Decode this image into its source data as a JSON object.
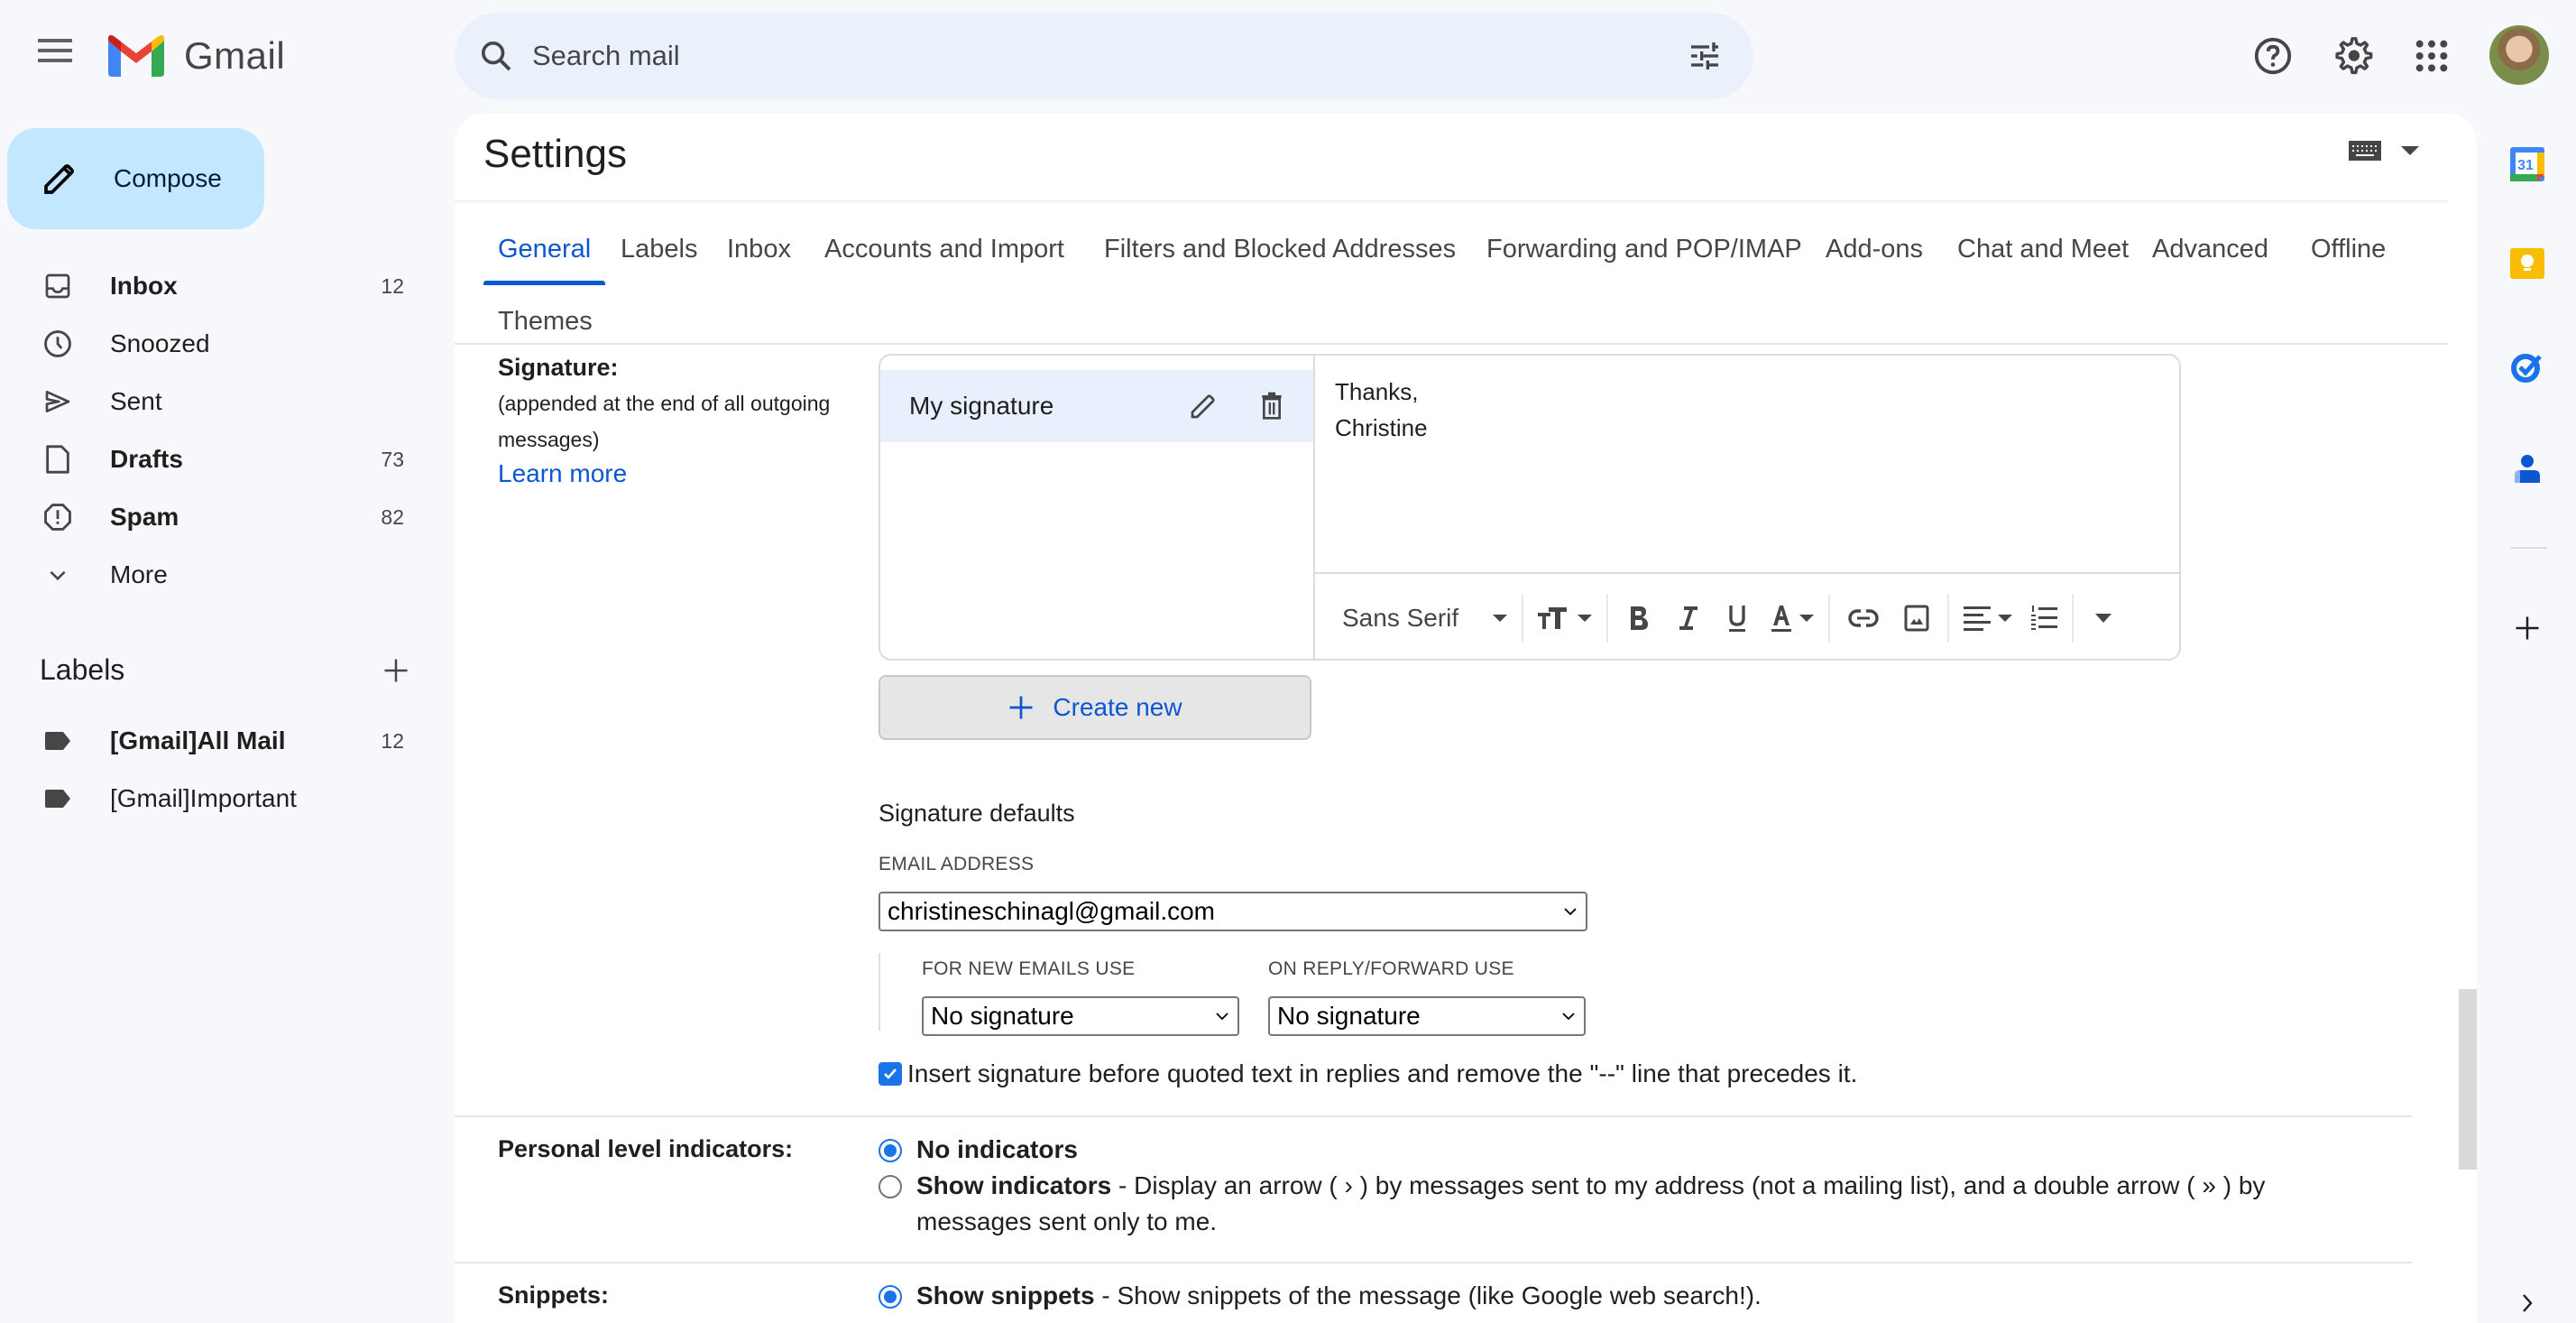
{
  "app": {
    "name": "Gmail"
  },
  "topbar": {
    "search_placeholder": "Search mail",
    "icons": [
      "menu-icon",
      "search-icon",
      "tune-icon",
      "help-icon",
      "gear-icon",
      "apps-grid-icon",
      "avatar"
    ]
  },
  "nav": {
    "compose_label": "Compose",
    "items": [
      {
        "label": "Inbox",
        "count": "12",
        "bold": true,
        "icon": "inbox-icon"
      },
      {
        "label": "Snoozed",
        "count": "",
        "bold": false,
        "icon": "clock-icon"
      },
      {
        "label": "Sent",
        "count": "",
        "bold": false,
        "icon": "send-icon"
      },
      {
        "label": "Drafts",
        "count": "73",
        "bold": true,
        "icon": "draft-icon"
      },
      {
        "label": "Spam",
        "count": "82",
        "bold": true,
        "icon": "spam-icon"
      },
      {
        "label": "More",
        "count": "",
        "bold": false,
        "icon": "chevron-down-icon"
      }
    ],
    "labels_heading": "Labels",
    "labels": [
      {
        "label": "[Gmail]All Mail",
        "count": "12",
        "bold": true
      },
      {
        "label": "[Gmail]Important",
        "count": "",
        "bold": false
      }
    ]
  },
  "settings": {
    "title": "Settings",
    "tabs": [
      "General",
      "Labels",
      "Inbox",
      "Accounts and Import",
      "Filters and Blocked Addresses",
      "Forwarding and POP/IMAP",
      "Add-ons",
      "Chat and Meet",
      "Advanced",
      "Offline",
      "Themes"
    ],
    "active_tab": "General",
    "signature": {
      "label": "Signature:",
      "sub_label": "(appended at the end of all outgoing messages)",
      "learn_more": "Learn more",
      "list": [
        {
          "name": "My signature"
        }
      ],
      "body_lines": [
        "Thanks,",
        "Christine"
      ],
      "toolbar": {
        "font": "Sans Serif"
      },
      "create_new": "Create new",
      "defaults_heading": "Signature defaults",
      "email_caption": "EMAIL ADDRESS",
      "email_value": "christineschinagl@gmail.com",
      "new_caption": "FOR NEW EMAILS USE",
      "new_value": "No signature",
      "reply_caption": "ON REPLY/FORWARD USE",
      "reply_value": "No signature",
      "insert_checkbox": {
        "checked": true,
        "label": "Insert signature before quoted text in replies and remove the \"--\" line that precedes it."
      }
    },
    "personal_level": {
      "label": "Personal level indicators:",
      "options": [
        {
          "title": "No indicators",
          "desc": "",
          "selected": true
        },
        {
          "title": "Show indicators",
          "desc": " - Display an arrow ( › ) by messages sent to my address (not a mailing list), and a double arrow ( » ) by messages sent only to me.",
          "selected": false
        }
      ]
    },
    "snippets": {
      "label": "Snippets:",
      "options": [
        {
          "title": "Show snippets",
          "desc": " - Show snippets of the message (like Google web search!).",
          "selected": true
        }
      ]
    }
  },
  "rail": [
    "calendar-icon",
    "keep-icon",
    "tasks-icon",
    "contacts-icon",
    "add-icon"
  ],
  "colors": {
    "accent": "#0b57d0",
    "compose_bg": "#c2e7ff",
    "search_bg": "#eaf1fb",
    "page_bg": "#f6f8fc"
  }
}
